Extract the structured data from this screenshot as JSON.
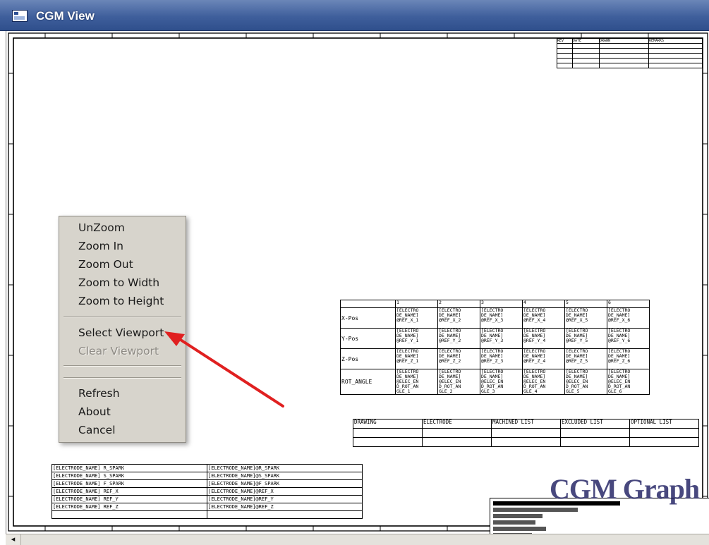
{
  "window": {
    "title": "CGM View"
  },
  "context_menu": {
    "items": [
      {
        "label": "UnZoom",
        "enabled": true
      },
      {
        "label": "Zoom In",
        "enabled": true
      },
      {
        "label": "Zoom Out",
        "enabled": true
      },
      {
        "label": "Zoom to Width",
        "enabled": true
      },
      {
        "label": "Zoom to Height",
        "enabled": true
      },
      {
        "label": "Select Viewport",
        "enabled": true
      },
      {
        "label": "Clear Viewport",
        "enabled": false
      },
      {
        "label": "Refresh",
        "enabled": true
      },
      {
        "label": "About",
        "enabled": true
      },
      {
        "label": "Cancel",
        "enabled": true
      }
    ]
  },
  "annotation": {
    "arrow_color": "#e02020"
  },
  "drawing": {
    "position_table": {
      "columns": [
        "1",
        "2",
        "3",
        "4",
        "5",
        "6"
      ],
      "rows": [
        {
          "label": "X-Pos",
          "cells": [
            "[ELECTRO\nDE_NAME]\n@REF_X_1",
            "[ELECTRO\nDE_NAME]\n@REF_X_2",
            "[ELECTRO\nDE_NAME]\n@REF_X_3",
            "[ELECTRO\nDE_NAME]\n@REF_X_4",
            "[ELECTRO\nDE_NAME]\n@REF_X_5",
            "[ELECTRO\nDE_NAME]\n@REF_X_6"
          ]
        },
        {
          "label": "Y-Pos",
          "cells": [
            "[ELECTRO\nDE_NAME]\n@REF_Y_1",
            "[ELECTRO\nDE_NAME]\n@REF_Y_2",
            "[ELECTRO\nDE_NAME]\n@REF_Y_3",
            "[ELECTRO\nDE_NAME]\n@REF_Y_4",
            "[ELECTRO\nDE_NAME]\n@REF_Y_5",
            "[ELECTRO\nDE_NAME]\n@REF_Y_6"
          ]
        },
        {
          "label": "Z-Pos",
          "cells": [
            "[ELECTRO\nDE_NAME]\n@REF_Z_1",
            "[ELECTRO\nDE_NAME]\n@REF_Z_2",
            "[ELECTRO\nDE_NAME]\n@REF_Z_3",
            "[ELECTRO\nDE_NAME]\n@REF_Z_4",
            "[ELECTRO\nDE_NAME]\n@REF_Z_5",
            "[ELECTRO\nDE_NAME]\n@REF_Z_6"
          ]
        },
        {
          "label": "ROT_ANGLE",
          "cells": [
            "[ELECTRO\nDE_NAME]\n@ELEC_EN\nD_ROT_AN\nGLE_1",
            "[ELECTRO\nDE_NAME]\n@ELEC_EN\nD_ROT_AN\nGLE_2",
            "[ELECTRO\nDE_NAME]\n@ELEC_EN\nD_ROT_AN\nGLE_3",
            "[ELECTRO\nDE_NAME]\n@ELEC_EN\nD_ROT_AN\nGLE_4",
            "[ELECTRO\nDE_NAME]\n@ELEC_EN\nD_ROT_AN\nGLE_5",
            "[ELECTRO\nDE_NAME]\n@ELEC_EN\nD_ROT_AN\nGLE_6"
          ]
        }
      ]
    },
    "list_table": {
      "headers": [
        "DRAWING",
        "ELECTRODE",
        "MACHINED LIST",
        "EXCLUDED LIST",
        "OPTIONAL LIST"
      ]
    },
    "electrode_table": {
      "rows": [
        [
          "[ELECTRODE_NAME] R_SPARK",
          "[ELECTRODE_NAME]@R_SPARK"
        ],
        [
          "[ELECTRODE_NAME] S_SPARK",
          "[ELECTRODE_NAME]@S_SPARK"
        ],
        [
          "[ELECTRODE_NAME] F_SPARK",
          "[ELECTRODE_NAME]@F_SPARK"
        ],
        [
          "[ELECTRODE_NAME] REF_X",
          "[ELECTRODE_NAME]@REF_X"
        ],
        [
          "[ELECTRODE_NAME] REF_Y",
          "[ELECTRODE_NAME]@REF_Y"
        ],
        [
          "[ELECTRODE_NAME] REF_Z",
          "[ELECTRODE_NAME]@REF_Z"
        ]
      ]
    },
    "revision_table": {
      "headers": [
        "REV",
        "DATE",
        "DRAWN",
        "REMARKS"
      ]
    },
    "title_block": {
      "watermark": "CGM Graph"
    }
  },
  "scrollbar": {
    "left_arrow": "◂"
  }
}
